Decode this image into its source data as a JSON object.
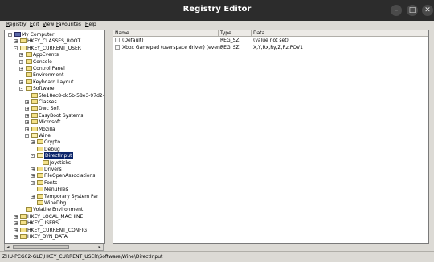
{
  "window": {
    "title": "Registry Editor",
    "controls": [
      "–",
      "□",
      "✕"
    ]
  },
  "menu": [
    {
      "pre": "",
      "u": "R",
      "post": "egistry"
    },
    {
      "pre": "",
      "u": "E",
      "post": "dit"
    },
    {
      "pre": "",
      "u": "V",
      "post": "iew"
    },
    {
      "pre": "",
      "u": "F",
      "post": "avourites"
    },
    {
      "pre": "",
      "u": "H",
      "post": "elp"
    }
  ],
  "tree": [
    {
      "label": "My Computer",
      "depth": 0,
      "exp": "-",
      "icon": "computer-icon"
    },
    {
      "label": "HKEY_CLASSES_ROOT",
      "depth": 1,
      "exp": "+",
      "icon": "folder-icon"
    },
    {
      "label": "HKEY_CURRENT_USER",
      "depth": 1,
      "exp": "-",
      "icon": "folder-open-icon"
    },
    {
      "label": "AppEvents",
      "depth": 2,
      "exp": "+",
      "icon": "folder-icon"
    },
    {
      "label": "Console",
      "depth": 2,
      "exp": "+",
      "icon": "folder-icon"
    },
    {
      "label": "Control Panel",
      "depth": 2,
      "exp": "+",
      "icon": "folder-icon"
    },
    {
      "label": "Environment",
      "depth": 2,
      "exp": "",
      "icon": "folder-icon"
    },
    {
      "label": "Keyboard Layout",
      "depth": 2,
      "exp": "+",
      "icon": "folder-icon"
    },
    {
      "label": "Software",
      "depth": 2,
      "exp": "-",
      "icon": "folder-open-icon"
    },
    {
      "label": "5fe18ec8-dc5b-58e3-97d2-",
      "depth": 3,
      "exp": "",
      "icon": "folder-icon"
    },
    {
      "label": "Classes",
      "depth": 3,
      "exp": "+",
      "icon": "folder-icon"
    },
    {
      "label": "Dwc Soft",
      "depth": 3,
      "exp": "+",
      "icon": "folder-icon"
    },
    {
      "label": "EasyBoot Systems",
      "depth": 3,
      "exp": "+",
      "icon": "folder-icon"
    },
    {
      "label": "Microsoft",
      "depth": 3,
      "exp": "+",
      "icon": "folder-icon"
    },
    {
      "label": "Mozilla",
      "depth": 3,
      "exp": "+",
      "icon": "folder-icon"
    },
    {
      "label": "Wine",
      "depth": 3,
      "exp": "-",
      "icon": "folder-open-icon"
    },
    {
      "label": "Crypto",
      "depth": 4,
      "exp": "+",
      "icon": "folder-icon"
    },
    {
      "label": "Debug",
      "depth": 4,
      "exp": "",
      "icon": "folder-icon"
    },
    {
      "label": "DirectInput",
      "depth": 4,
      "exp": "-",
      "icon": "folder-open-icon",
      "selected": true
    },
    {
      "label": "Joysticks",
      "depth": 5,
      "exp": "",
      "icon": "folder-icon"
    },
    {
      "label": "Drivers",
      "depth": 4,
      "exp": "+",
      "icon": "folder-icon"
    },
    {
      "label": "FileOpenAssociations",
      "depth": 4,
      "exp": "+",
      "icon": "folder-icon"
    },
    {
      "label": "Fonts",
      "depth": 4,
      "exp": "+",
      "icon": "folder-icon"
    },
    {
      "label": "MenuFiles",
      "depth": 4,
      "exp": "",
      "icon": "folder-icon"
    },
    {
      "label": "Temporary System Par",
      "depth": 4,
      "exp": "+",
      "icon": "folder-icon"
    },
    {
      "label": "WineDbg",
      "depth": 4,
      "exp": "",
      "icon": "folder-icon"
    },
    {
      "label": "Volatile Environment",
      "depth": 2,
      "exp": "",
      "icon": "folder-icon"
    },
    {
      "label": "HKEY_LOCAL_MACHINE",
      "depth": 1,
      "exp": "+",
      "icon": "folder-icon"
    },
    {
      "label": "HKEY_USERS",
      "depth": 1,
      "exp": "+",
      "icon": "folder-icon"
    },
    {
      "label": "HKEY_CURRENT_CONFIG",
      "depth": 1,
      "exp": "+",
      "icon": "folder-icon"
    },
    {
      "label": "HKEY_DYN_DATA",
      "depth": 1,
      "exp": "+",
      "icon": "folder-icon"
    }
  ],
  "list": {
    "columns": [
      "Name",
      "Type",
      "Data"
    ],
    "rows": [
      {
        "name": "(Default)",
        "type": "REG_SZ",
        "data": "(value not set)"
      },
      {
        "name": "Xbox Gamepad (userspace driver) (event)",
        "type": "REG_SZ",
        "data": "X,Y,Rx,Ry,Z,Rz,POV1"
      }
    ]
  },
  "scrollbar": {
    "left": "◂",
    "right": "▸"
  },
  "status": "ZHU-PCG02-GLE\\HKEY_CURRENT_USER\\Software\\Wine\\DirectInput"
}
